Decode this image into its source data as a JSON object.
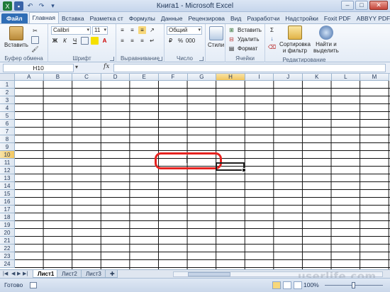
{
  "window": {
    "title": "Книга1 - Microsoft Excel",
    "controls": [
      "–",
      "□",
      "✕"
    ]
  },
  "quick_access": {
    "icons": [
      "excel-icon",
      "save-icon",
      "undo-icon",
      "redo-icon",
      "customize-icon"
    ]
  },
  "tabs": [
    "Файл",
    "Главная",
    "Вставка",
    "Разметка ст",
    "Формулы",
    "Данные",
    "Рецензирова",
    "Вид",
    "Разработчи",
    "Надстройки",
    "Foxit PDF",
    "ABBYY PDF T"
  ],
  "ribbon": {
    "clipboard": {
      "label": "Буфер обмена",
      "paste": "Вставить"
    },
    "font": {
      "label": "Шрифт",
      "name": "Calibri",
      "size": "11"
    },
    "alignment": {
      "label": "Выравнивание"
    },
    "number": {
      "label": "Число",
      "format": "Общий"
    },
    "styles": {
      "label": "",
      "button": "Стили"
    },
    "cells": {
      "label": "Ячейки",
      "insert": "Вставить",
      "delete": "Удалить",
      "format": "Формат"
    },
    "editing": {
      "label": "Редактирование",
      "sort": "Сортировка",
      "sort2": "и фильтр",
      "find": "Найти и",
      "find2": "выделить"
    }
  },
  "formula_bar": {
    "name_box": "H10",
    "fx": "fx",
    "value": ""
  },
  "grid": {
    "columns": [
      "A",
      "B",
      "C",
      "D",
      "E",
      "F",
      "G",
      "H",
      "I",
      "J",
      "K",
      "L",
      "M"
    ],
    "selected_column": "H",
    "rows": [
      "1",
      "2",
      "3",
      "4",
      "5",
      "6",
      "7",
      "8",
      "9",
      "10",
      "11",
      "12",
      "13",
      "14",
      "15",
      "16",
      "17",
      "18",
      "19",
      "20",
      "21",
      "22",
      "23",
      "24"
    ],
    "selected_row": "10"
  },
  "sheets": {
    "tabs": [
      "Лист1",
      "Лист2",
      "Лист3"
    ],
    "active": "Лист1"
  },
  "status": {
    "ready": "Готово",
    "zoom": "100%"
  },
  "watermark": "userlife.com"
}
